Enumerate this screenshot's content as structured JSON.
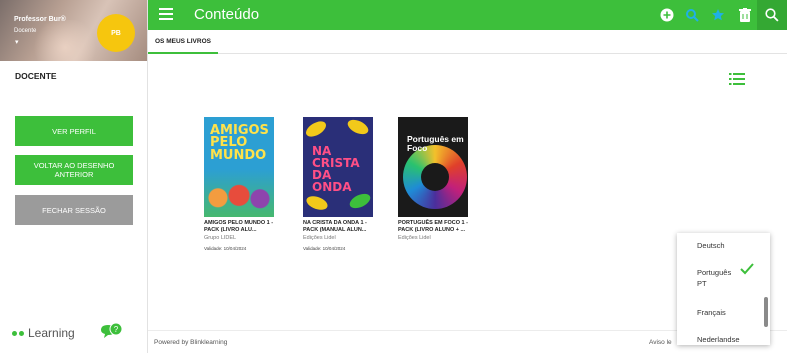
{
  "profile": {
    "name": "Professor Bur®",
    "role": "Docente",
    "avatar_text": "PB"
  },
  "sidebar": {
    "section_title": "DOCENTE",
    "buttons": [
      {
        "label": "VER PERFIL",
        "style": "green"
      },
      {
        "label": "VOLTAR AO DESENHO ANTERIOR",
        "style": "green"
      },
      {
        "label": "FECHAR SESSÃO",
        "style": "grey"
      }
    ],
    "logo_text": "Learning"
  },
  "topbar": {
    "title": "Conteúdo",
    "icons": [
      "add-icon",
      "search-user-icon",
      "star-icon",
      "trash-icon",
      "search-icon"
    ]
  },
  "tabs": [
    {
      "label": "OS MEUS LIVROS",
      "active": true
    }
  ],
  "books": [
    {
      "cover_title": "AMIGOS PELO MUNDO",
      "title": "AMIGOS PELO MUNDO 1 - PACK (LIVRO ALU...",
      "publisher": "Grupo LIDEL",
      "date": "Validade: 10/04/2024"
    },
    {
      "cover_title": "NA CRISTA DA ONDA",
      "title": "NA CRISTA DA ONDA 1 - PACK (MANUAL ALUN...",
      "publisher": "Edições Lidel",
      "date": "Validade: 10/04/2024"
    },
    {
      "cover_title": "Português em Foco",
      "title": "PORTUGUÊS EM FOCO 1 - PACK (LIVRO ALUNO + ...",
      "publisher": "Edições Lidel",
      "date": ""
    }
  ],
  "footer": {
    "powered": "Powered by Blinklearning",
    "notice": "Aviso le"
  },
  "language_menu": {
    "items": [
      "Deutsch",
      "Português PT",
      "Français",
      "Nederlandse"
    ],
    "selected": "Português PT"
  },
  "colors": {
    "brand_green": "#3dbf3b",
    "topbar_search_bg": "#34a833",
    "button_grey": "#9b9b9b",
    "avatar_yellow": "#f6c60e"
  }
}
